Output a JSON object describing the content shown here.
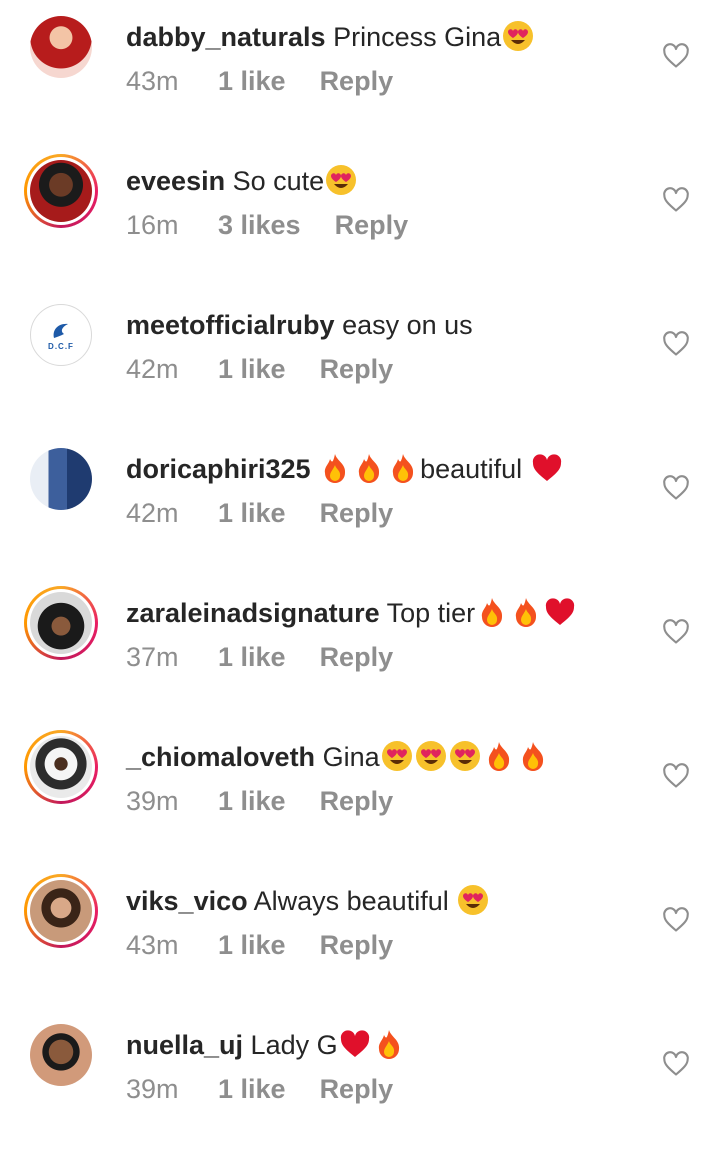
{
  "comments": [
    {
      "username": "dabby_naturals",
      "text": "Princess Gina",
      "emojis": [
        "heart-eyes"
      ],
      "time": "43m",
      "likes": "1 like",
      "reply": "Reply",
      "ring": false,
      "avatar_colors": [
        "#c0392b",
        "#f5b7b1"
      ]
    },
    {
      "username": "eveesin",
      "text": "So cute",
      "emojis": [
        "heart-eyes"
      ],
      "time": "16m",
      "likes": "3 likes",
      "reply": "Reply",
      "ring": true,
      "avatar_colors": [
        "#6d1f1f",
        "#c0392b"
      ]
    },
    {
      "username": "meetofficialruby",
      "text": "easy on us",
      "emojis": [],
      "time": "42m",
      "likes": "1 like",
      "reply": "Reply",
      "ring": false,
      "avatar_colors": [
        "#ffffff",
        "#1e5aa8"
      ]
    },
    {
      "username": "doricaphiri325",
      "text": "beautiful",
      "emojis_before": [
        "fire",
        "fire",
        "fire"
      ],
      "emojis": [
        "red-heart"
      ],
      "time": "42m",
      "likes": "1 like",
      "reply": "Reply",
      "ring": false,
      "avatar_colors": [
        "#7fa7d6",
        "#2c4f8a"
      ]
    },
    {
      "username": "zaraleinadsignature",
      "text": "Top tier",
      "emojis": [
        "fire",
        "fire",
        "red-heart"
      ],
      "time": "37m",
      "likes": "1 like",
      "reply": "Reply",
      "ring": true,
      "avatar_colors": [
        "#d9d9d9",
        "#222222"
      ]
    },
    {
      "username": "_chiomaloveth",
      "text": "Gina",
      "emojis": [
        "heart-eyes",
        "heart-eyes",
        "heart-eyes",
        "fire",
        "fire"
      ],
      "time": "39m",
      "likes": "1 like",
      "reply": "Reply",
      "ring": true,
      "avatar_colors": [
        "#e8e8e8",
        "#2c2c2c"
      ]
    },
    {
      "username": "viks_vico",
      "text": "Always beautiful",
      "emojis": [
        "heart-eyes"
      ],
      "time": "43m",
      "likes": "1 like",
      "reply": "Reply",
      "ring": true,
      "avatar_colors": [
        "#c89a7a",
        "#4a2e1e"
      ]
    },
    {
      "username": "nuella_uj",
      "text": "Lady G",
      "emojis": [
        "red-heart",
        "fire"
      ],
      "time": "39m",
      "likes": "1 like",
      "reply": "Reply",
      "ring": false,
      "avatar_colors": [
        "#8a5a3c",
        "#d19a7a"
      ]
    }
  ],
  "colors": {
    "username": "#262626",
    "meta": "#8e8e8e",
    "heart_outline": "#8e8e8e"
  },
  "icons": {
    "like": "heart-outline-icon"
  }
}
